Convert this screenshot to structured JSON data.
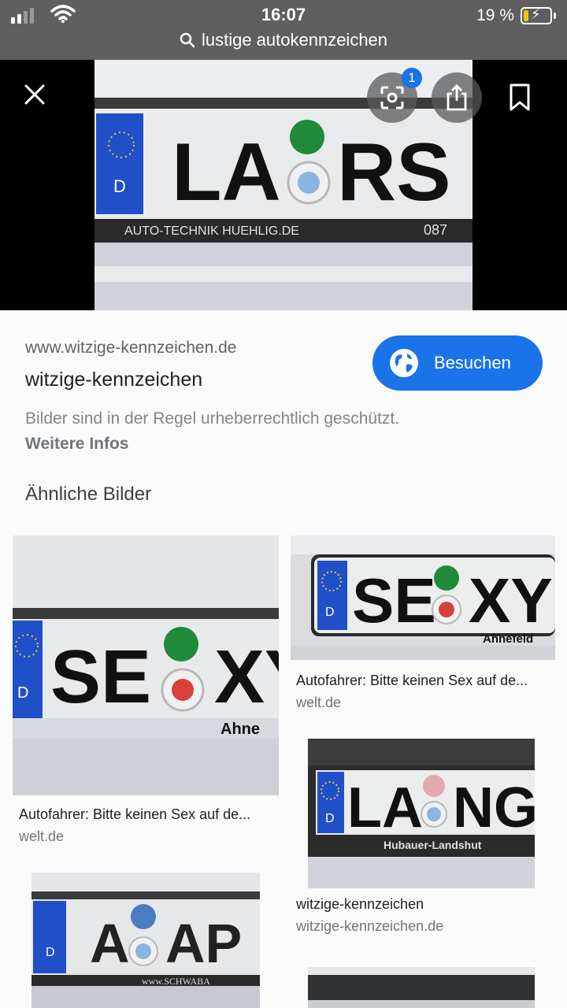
{
  "status_bar": {
    "time": "16:07",
    "battery": "19 %",
    "search_query": "lustige autokennzeichen"
  },
  "viewer": {
    "lens_badge_count": "1",
    "plate_main": {
      "left": "LA",
      "right": "RS",
      "country": "D",
      "dealer": "AUTO-TECHNIK HUEHLIG.DE",
      "phone": "087"
    }
  },
  "source": {
    "url": "www.witzige-kennzeichen.de",
    "name": "witzige-kennzeichen",
    "visit_label": "Besuchen",
    "copyright_notice": "Bilder sind in der Regel urheberrechtlich geschützt.",
    "more_info_label": "Weitere Infos"
  },
  "similar": {
    "heading": "Ähnliche Bilder",
    "items": [
      {
        "title": "Autofahrer: Bitte keinen Sex auf de...",
        "source": "welt.de",
        "plate_left": "SE",
        "plate_right": "XY",
        "dealer": "Ahne",
        "country": "D"
      },
      {
        "title": "Autofahrer: Bitte keinen Sex auf de...",
        "source": "welt.de",
        "plate_left": "SE",
        "plate_right": "XY",
        "dealer": "Ahnefeld",
        "country": "D"
      },
      {
        "title": "witzige-kennzeichen",
        "source": "witzige-kennzeichen.de",
        "plate_left": "LA",
        "plate_right": "NG",
        "dealer": "Hubauer-Landshut",
        "country": "D"
      },
      {
        "plate_left": "A",
        "plate_right": "AP",
        "dealer": "www.SCHWABA",
        "country": "D"
      }
    ]
  },
  "colors": {
    "accent": "#1a73e8",
    "status_bar": "#5f5f5f",
    "eu_blue": "#2050c8"
  }
}
